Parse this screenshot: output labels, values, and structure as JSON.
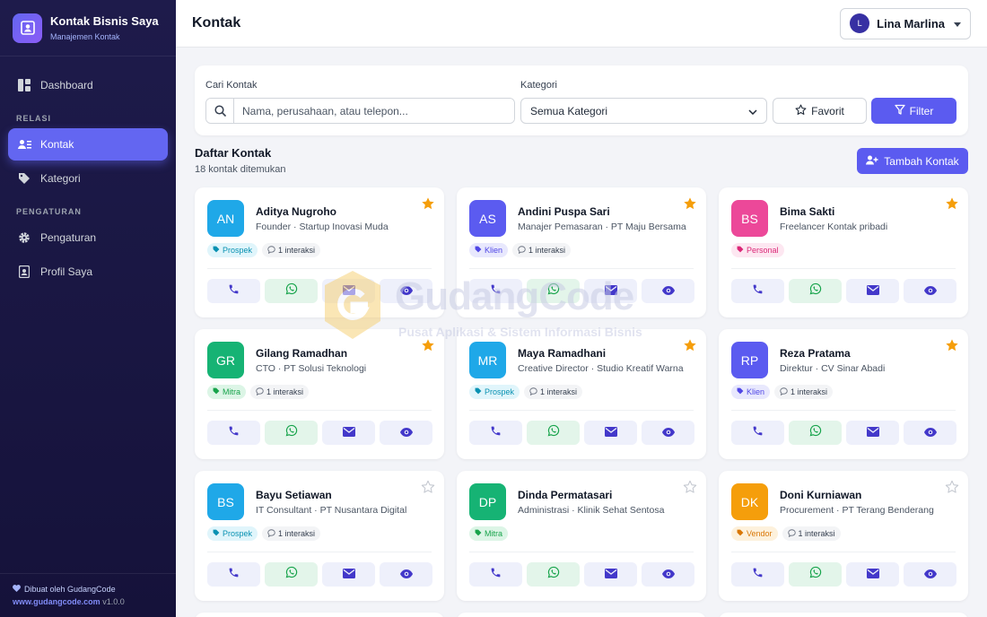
{
  "app": {
    "title": "Kontak Bisnis Saya",
    "subtitle": "Manajemen Kontak"
  },
  "sidebar": {
    "items": [
      {
        "label": "Dashboard",
        "icon": "dashboard-icon"
      },
      {
        "section": "RELASI"
      },
      {
        "label": "Kontak",
        "icon": "contacts-icon",
        "active": true
      },
      {
        "label": "Kategori",
        "icon": "tag-icon"
      },
      {
        "section": "PENGATURAN"
      },
      {
        "label": "Pengaturan",
        "icon": "gear-icon"
      },
      {
        "label": "Profil Saya",
        "icon": "id-badge-icon"
      }
    ],
    "sections": {
      "relasi": "RELASI",
      "pengaturan": "PENGATURAN"
    },
    "labels": {
      "dashboard": "Dashboard",
      "kontak": "Kontak",
      "kategori": "Kategori",
      "pengaturan": "Pengaturan",
      "profil": "Profil Saya"
    },
    "footer": {
      "made_by": "Dibuat oleh GudangCode",
      "url": "www.gudangcode.com",
      "version": "v1.0.0"
    }
  },
  "header": {
    "title": "Kontak",
    "user": {
      "name": "Lina Marlina",
      "initial": "L"
    }
  },
  "filter": {
    "search_label": "Cari Kontak",
    "search_placeholder": "Nama, perusahaan, atau telepon...",
    "category_label": "Kategori",
    "category_value": "Semua Kategori",
    "favorite_label": "Favorit",
    "filter_label": "Filter"
  },
  "list": {
    "title": "Daftar Kontak",
    "count": "18 kontak ditemukan",
    "add_label": "Tambah Kontak"
  },
  "colors": {
    "accent": "#5b5bf0",
    "sidebar_bg": "#1e1b4b",
    "star": "#f59e0b"
  },
  "contacts": [
    {
      "initials": "AN",
      "name": "Aditya Nugroho",
      "subtitle": "Founder · Startup Inovasi Muda",
      "tag": "Prospek",
      "tag_bg": "#e0f5fb",
      "tag_fg": "#0891b2",
      "interactions": "1 interaksi",
      "favorite": true,
      "avatar_color": "#1fa8e8"
    },
    {
      "initials": "AS",
      "name": "Andini Puspa Sari",
      "subtitle": "Manajer Pemasaran · PT Maju Bersama",
      "tag": "Klien",
      "tag_bg": "#e8e8fd",
      "tag_fg": "#4f46e5",
      "interactions": "1 interaksi",
      "favorite": true,
      "avatar_color": "#5b5bf0"
    },
    {
      "initials": "BS",
      "name": "Bima Sakti",
      "subtitle": "Freelancer Kontak pribadi",
      "tag": "Personal",
      "tag_bg": "#fde7f1",
      "tag_fg": "#db2777",
      "interactions": "",
      "favorite": true,
      "avatar_color": "#ec4899"
    },
    {
      "initials": "GR",
      "name": "Gilang Ramadhan",
      "subtitle": "CTO · PT Solusi Teknologi",
      "tag": "Mitra",
      "tag_bg": "#dcf5e6",
      "tag_fg": "#16a34a",
      "interactions": "1 interaksi",
      "favorite": true,
      "avatar_color": "#16b374"
    },
    {
      "initials": "MR",
      "name": "Maya Ramadhani",
      "subtitle": "Creative Director · Studio Kreatif Warna",
      "tag": "Prospek",
      "tag_bg": "#e0f5fb",
      "tag_fg": "#0891b2",
      "interactions": "1 interaksi",
      "favorite": true,
      "avatar_color": "#1fa8e8"
    },
    {
      "initials": "RP",
      "name": "Reza Pratama",
      "subtitle": "Direktur · CV Sinar Abadi",
      "tag": "Klien",
      "tag_bg": "#e8e8fd",
      "tag_fg": "#4f46e5",
      "interactions": "1 interaksi",
      "favorite": true,
      "avatar_color": "#5b5bf0"
    },
    {
      "initials": "BS",
      "name": "Bayu Setiawan",
      "subtitle": "IT Consultant · PT Nusantara Digital",
      "tag": "Prospek",
      "tag_bg": "#e0f5fb",
      "tag_fg": "#0891b2",
      "interactions": "1 interaksi",
      "favorite": false,
      "avatar_color": "#1fa8e8"
    },
    {
      "initials": "DP",
      "name": "Dinda Permatasari",
      "subtitle": "Administrasi · Klinik Sehat Sentosa",
      "tag": "Mitra",
      "tag_bg": "#dcf5e6",
      "tag_fg": "#16a34a",
      "interactions": "",
      "favorite": false,
      "avatar_color": "#16b374"
    },
    {
      "initials": "DK",
      "name": "Doni Kurniawan",
      "subtitle": "Procurement · PT Terang Benderang",
      "tag": "Vendor",
      "tag_bg": "#fdf1dc",
      "tag_fg": "#d97706",
      "interactions": "1 interaksi",
      "favorite": false,
      "avatar_color": "#f59e0b"
    }
  ],
  "watermark": {
    "brand": "GudangCode",
    "tagline": "Pusat Aplikasi & Sistem Informasi Bisnis"
  }
}
